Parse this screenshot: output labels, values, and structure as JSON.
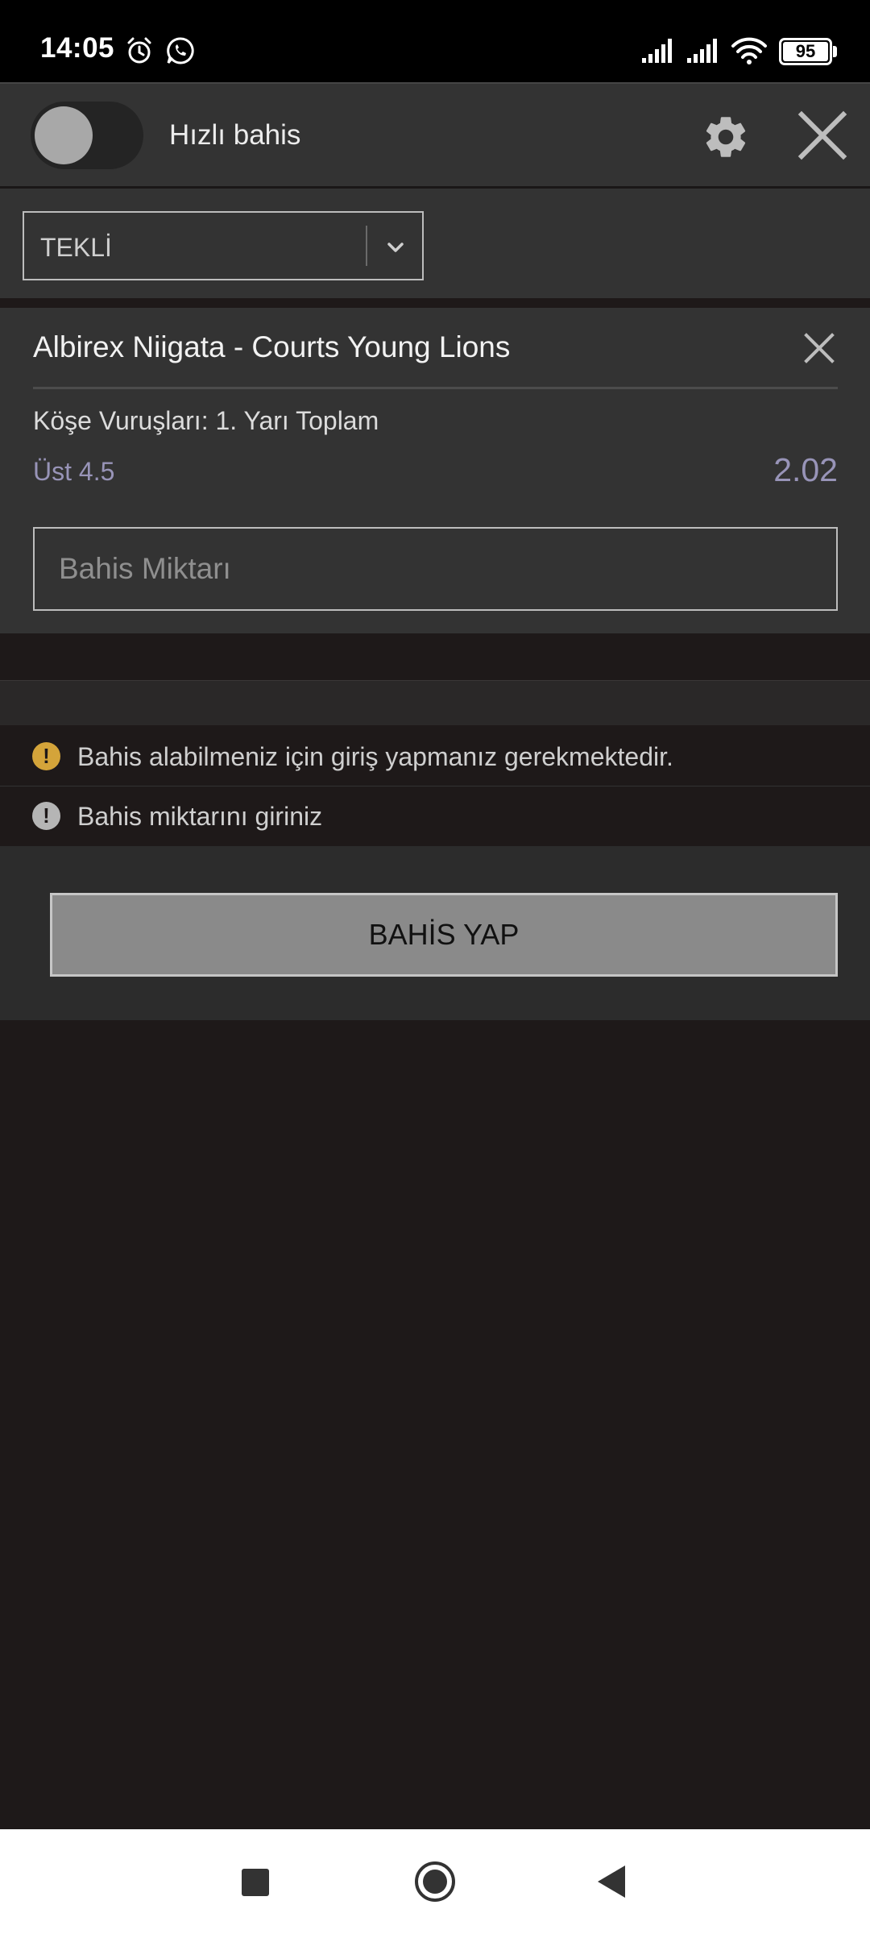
{
  "status_bar": {
    "time": "14:05",
    "battery": "95",
    "icons": [
      "alarm-icon",
      "whatsapp-icon",
      "signal-icon",
      "signal-icon",
      "wifi-icon",
      "battery-icon"
    ]
  },
  "header": {
    "quick_bet_label": "Hızlı bahis",
    "quick_bet_on": false
  },
  "bet_type": {
    "selected": "TEKLİ"
  },
  "bet": {
    "match": "Albirex Niigata - Courts Young Lions",
    "market": "Köşe Vuruşları: 1. Yarı Toplam",
    "selection": "Üst 4.5",
    "odds": "2.02",
    "stake_placeholder": "Bahis Miktarı",
    "stake_value": ""
  },
  "messages": [
    {
      "text": "Bahis alabilmeniz için giriş yapmanız gerekmektedir.",
      "color": "#d4a43a"
    },
    {
      "text": "Bahis miktarını giriniz",
      "color": "#b5b5b5"
    }
  ],
  "actions": {
    "place_bet_label": "BAHİS YAP"
  },
  "colors": {
    "panel": "#333333",
    "background": "#1e1919",
    "accent_odds": "#9894b8",
    "warning": "#d4a43a"
  }
}
